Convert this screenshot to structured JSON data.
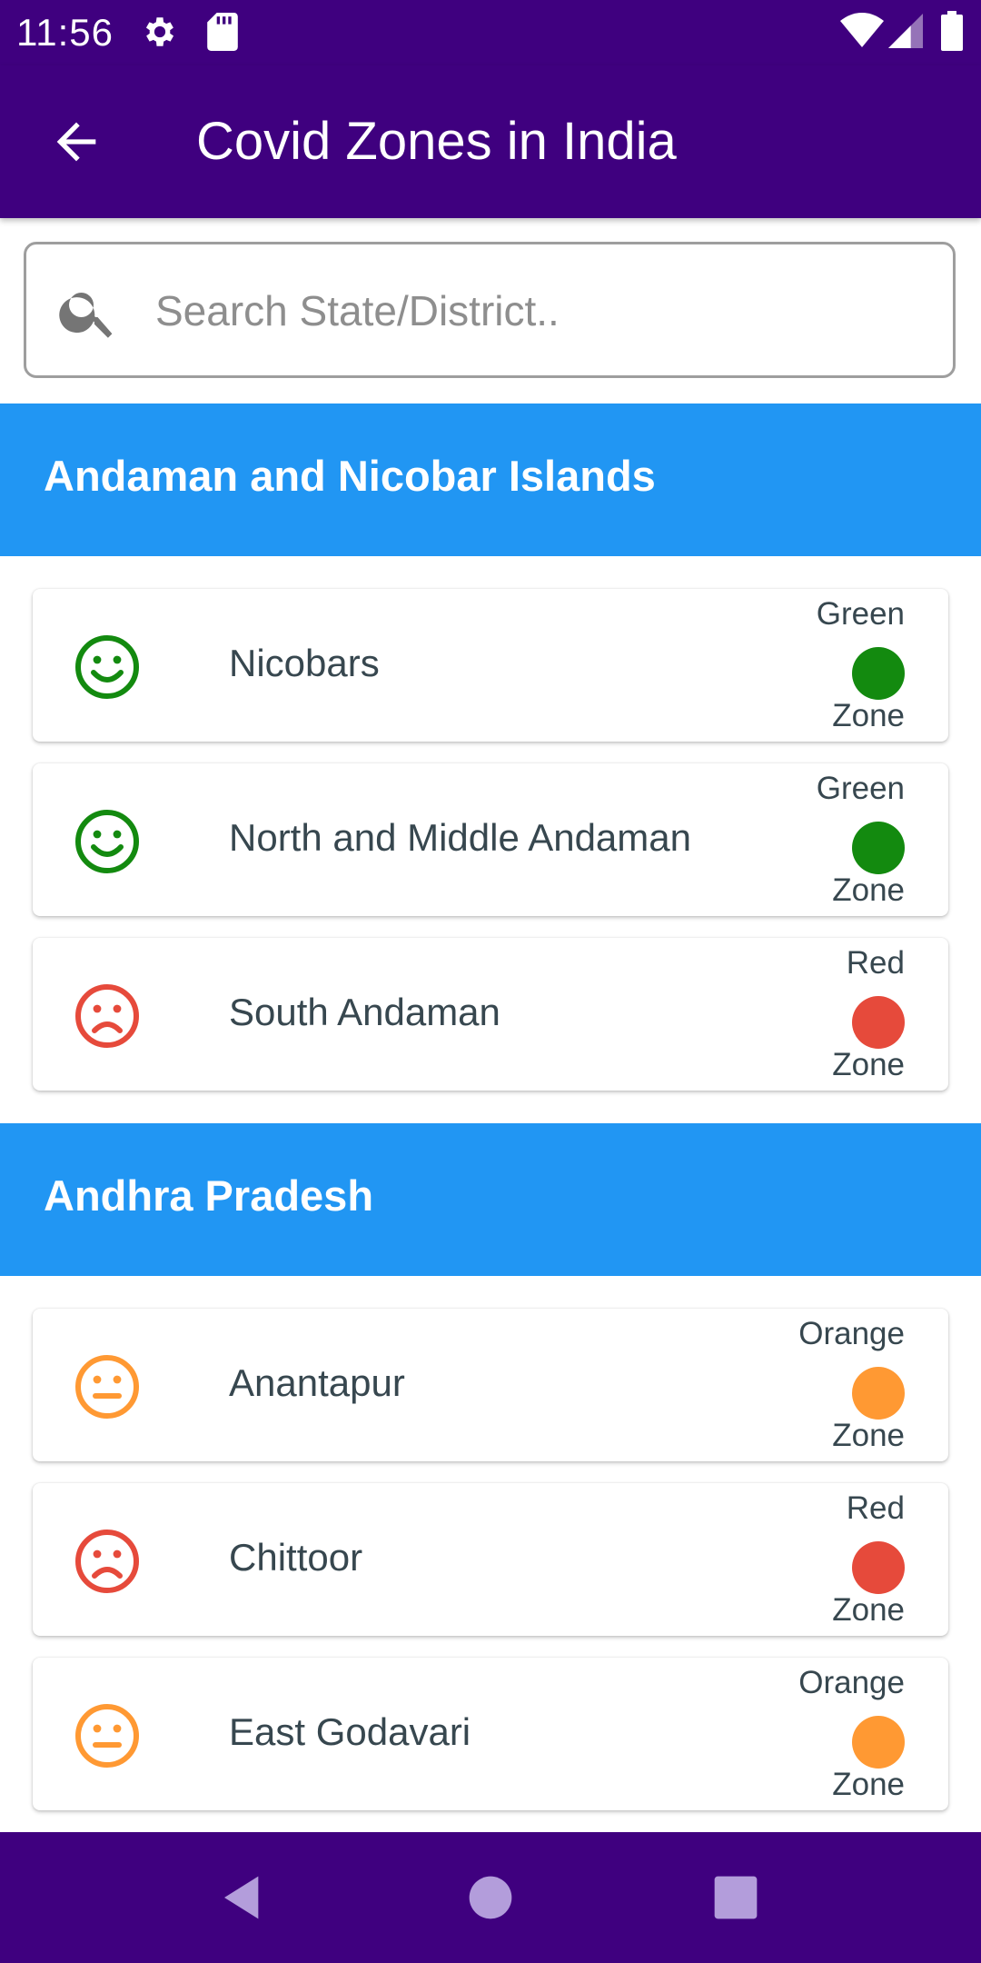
{
  "status_bar": {
    "time": "11:56"
  },
  "app_bar": {
    "title": "Covid Zones in India",
    "back_icon": "arrow-back-icon"
  },
  "search": {
    "placeholder": "Search State/District..",
    "value": ""
  },
  "colors": {
    "primary": "#3f007f",
    "section_header": "#2196f3",
    "green": "#138a0f",
    "red": "#e64a3b",
    "orange": "#ff9933"
  },
  "states": [
    {
      "name": "Andaman and Nicobar Islands",
      "districts": [
        {
          "name": "Nicobars",
          "zone": "Green",
          "zone_label": "Zone",
          "face": "smile-icon"
        },
        {
          "name": "North and Middle Andaman",
          "zone": "Green",
          "zone_label": "Zone",
          "face": "smile-icon"
        },
        {
          "name": "South Andaman",
          "zone": "Red",
          "zone_label": "Zone",
          "face": "sad-icon"
        }
      ]
    },
    {
      "name": "Andhra Pradesh",
      "districts": [
        {
          "name": "Anantapur",
          "zone": "Orange",
          "zone_label": "Zone",
          "face": "neutral-icon"
        },
        {
          "name": "Chittoor",
          "zone": "Red",
          "zone_label": "Zone",
          "face": "sad-icon"
        },
        {
          "name": "East Godavari",
          "zone": "Orange",
          "zone_label": "Zone",
          "face": "neutral-icon"
        }
      ]
    }
  ]
}
